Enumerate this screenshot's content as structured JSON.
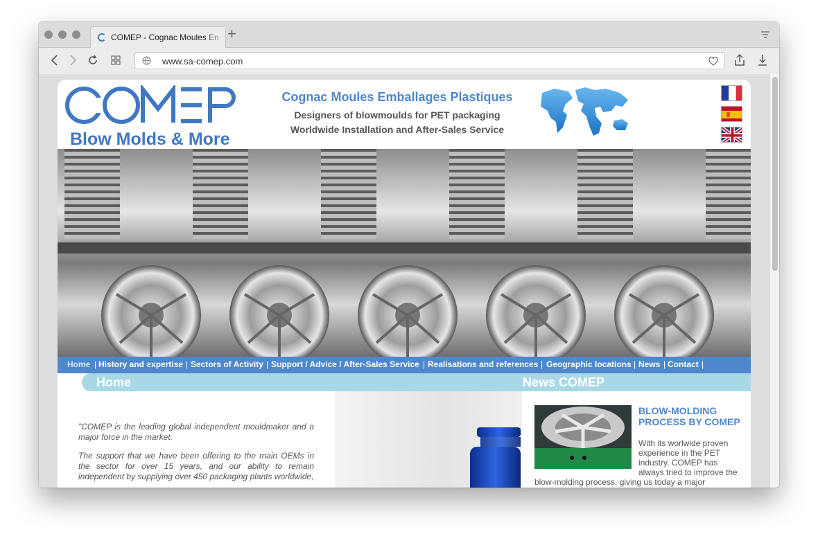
{
  "browser": {
    "tab_title": "COMEP - Cognac Moules Emballages Plastiques",
    "new_tab": "+",
    "url": "www.sa-comep.com"
  },
  "site": {
    "logo_main": "COMEP",
    "logo_sub": "Blow Molds & More",
    "title": "Cognac Moules Emballages Plastiques",
    "tagline1": "Designers of blowmoulds for PET packaging",
    "tagline2": "Worldwide Installation and After-Sales Service",
    "flags": [
      "flag-france",
      "flag-spain",
      "flag-uk"
    ]
  },
  "nav": {
    "items": [
      {
        "label": "Home",
        "active": true
      },
      {
        "label": "History and expertise",
        "active": false
      },
      {
        "label": "Sectors of Activity",
        "active": false
      },
      {
        "label": "Support / Advice / After-Sales Service",
        "active": false
      },
      {
        "label": "Realisations and references",
        "active": false
      },
      {
        "label": "Geographic locations",
        "active": false
      },
      {
        "label": "News",
        "active": false
      },
      {
        "label": "Contact",
        "active": false
      }
    ]
  },
  "home": {
    "section_title": "Home",
    "intro_p1": "\"COMEP is the leading global independent mouldmaker and a major force in the market.",
    "intro_p2": "The support that we have been offering to the main OEMs in the sector for over 15 years, and our ability to remain independent by supplying over 450 packaging plants worldwide,"
  },
  "news": {
    "section_title": "News COMEP",
    "item_title": "BLOW-MOLDING PROCESS BY COMEP",
    "item_body_1": "With its worlwide proven experience in the PET industry, COMEP has always tried to improve the",
    "item_body_2": "blow-molding process, giving us today a major"
  },
  "colors": {
    "brand_blue": "#4f87cc",
    "section_bar": "#a8d8e6"
  }
}
